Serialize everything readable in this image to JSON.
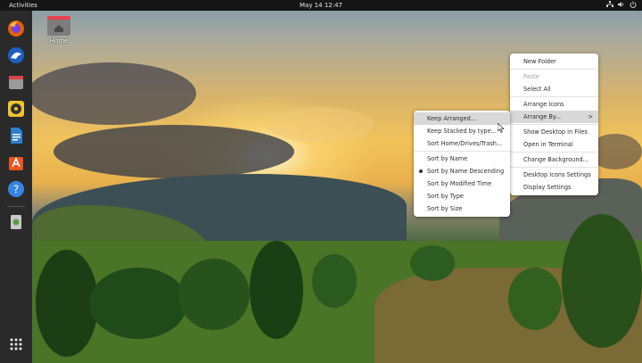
{
  "topbar": {
    "activities": "Activities",
    "date_time": "May 14  12:47"
  },
  "dock": {
    "items": [
      {
        "name": "firefox",
        "color": "#e66000"
      },
      {
        "name": "mail",
        "color": "#3d7ad6"
      },
      {
        "name": "files",
        "color": "#c94a4a"
      },
      {
        "name": "rhythmbox",
        "color": "#e8b92c"
      },
      {
        "name": "writer",
        "color": "#2d7fd0"
      },
      {
        "name": "software",
        "color": "#e95420"
      },
      {
        "name": "help",
        "color": "#3584e4"
      },
      {
        "name": "trash",
        "color": "#5e8f4a"
      }
    ],
    "show_apps_icon": "grid-icon"
  },
  "desktop": {
    "home_label": "Home"
  },
  "context_menu": {
    "items": [
      {
        "label": "New Folder",
        "disabled": false
      },
      {
        "label": "Paste",
        "disabled": true
      },
      {
        "label": "Select All",
        "disabled": false
      },
      {
        "label": "Arrange Icons",
        "disabled": false
      },
      {
        "label": "Arrange By...",
        "disabled": false,
        "submenu": true
      },
      {
        "label": "Show Desktop in Files",
        "disabled": false
      },
      {
        "label": "Open in Terminal",
        "disabled": false
      },
      {
        "label": "Change Background...",
        "disabled": false
      },
      {
        "label": "Desktop Icons Settings",
        "disabled": false
      },
      {
        "label": "Display Settings",
        "disabled": false
      }
    ]
  },
  "submenu": {
    "items": [
      {
        "label": "Keep Arranged..."
      },
      {
        "label": "Keep Stacked by type..."
      },
      {
        "label": "Sort Home/Drives/Trash..."
      },
      {
        "label": "Sort by Name"
      },
      {
        "label": "Sort by Name Descending",
        "selected": true
      },
      {
        "label": "Sort by Modified Time"
      },
      {
        "label": "Sort by Type"
      },
      {
        "label": "Sort by Size"
      }
    ]
  },
  "submenu_arrow": ">"
}
